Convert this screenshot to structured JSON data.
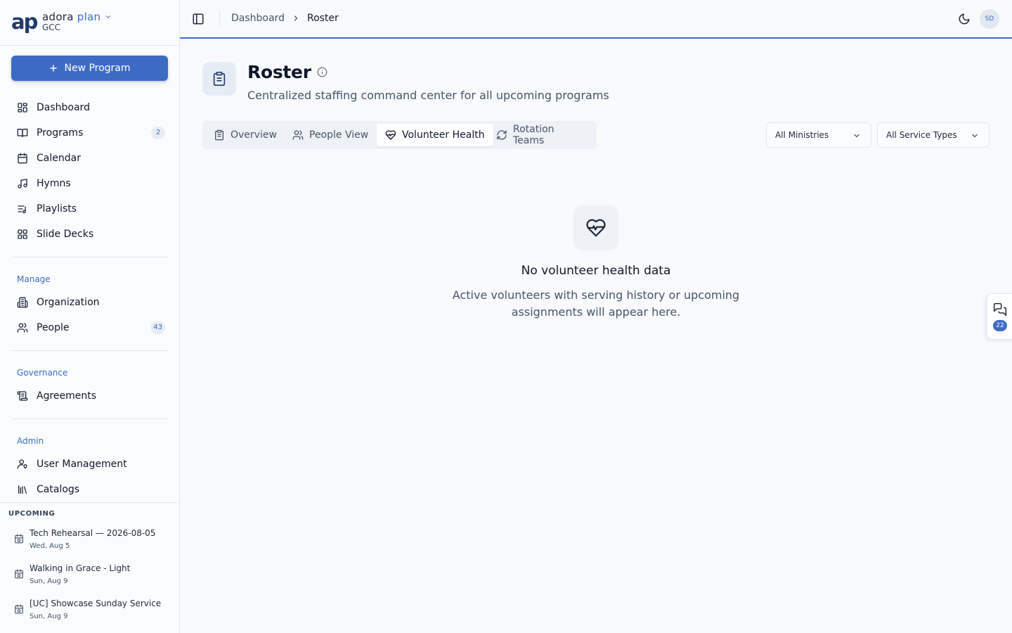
{
  "brand": {
    "logo": "ap",
    "name_part1": "adora",
    "name_part2": "plan",
    "org": "GCC"
  },
  "sidebar": {
    "new_program_label": "New Program",
    "main_items": [
      {
        "label": "Dashboard",
        "icon": "dashboard-icon"
      },
      {
        "label": "Programs",
        "icon": "book-icon",
        "badge": "2"
      },
      {
        "label": "Calendar",
        "icon": "calendar-icon"
      },
      {
        "label": "Hymns",
        "icon": "music-icon"
      },
      {
        "label": "Playlists",
        "icon": "playlist-icon"
      },
      {
        "label": "Slide Decks",
        "icon": "slides-icon"
      }
    ],
    "manage": {
      "label": "Manage",
      "items": [
        {
          "label": "Organization",
          "icon": "building-icon"
        },
        {
          "label": "People",
          "icon": "users-icon",
          "badge": "43"
        }
      ]
    },
    "governance": {
      "label": "Governance",
      "items": [
        {
          "label": "Agreements",
          "icon": "scroll-icon"
        }
      ]
    },
    "admin": {
      "label": "Admin",
      "items": [
        {
          "label": "User Management",
          "icon": "user-key-icon"
        },
        {
          "label": "Catalogs",
          "icon": "library-icon"
        }
      ]
    },
    "upcoming": {
      "title": "UPCOMING",
      "items": [
        {
          "title": "Tech Rehearsal — 2026-08-05",
          "date": "Wed, Aug 5"
        },
        {
          "title": "Walking in Grace - Light",
          "date": "Sun, Aug 9"
        },
        {
          "title": "[UC] Showcase Sunday Service",
          "date": "Sun, Aug 9"
        }
      ]
    }
  },
  "header": {
    "breadcrumb": [
      "Dashboard",
      "Roster"
    ],
    "avatar_initials": "SD"
  },
  "page": {
    "title": "Roster",
    "subtitle": "Centralized staffing command center for all upcoming programs",
    "tabs": [
      {
        "label": "Overview",
        "icon": "clipboard-icon"
      },
      {
        "label": "People View",
        "icon": "users-icon"
      },
      {
        "label": "Volunteer Health",
        "icon": "heart-pulse-icon",
        "active": true
      },
      {
        "label": "Rotation Teams",
        "icon": "refresh-icon"
      }
    ],
    "filters": {
      "ministry": "All Ministries",
      "service_type": "All Service Types"
    },
    "empty_state": {
      "icon": "heart-pulse-icon",
      "title": "No volunteer health data",
      "description": "Active volunteers with serving history or upcoming assignments will appear here."
    }
  },
  "chat": {
    "count": "22"
  },
  "colors": {
    "accent": "#3d6bc4",
    "background": "#f8fafc",
    "border": "#e2e8f0"
  }
}
